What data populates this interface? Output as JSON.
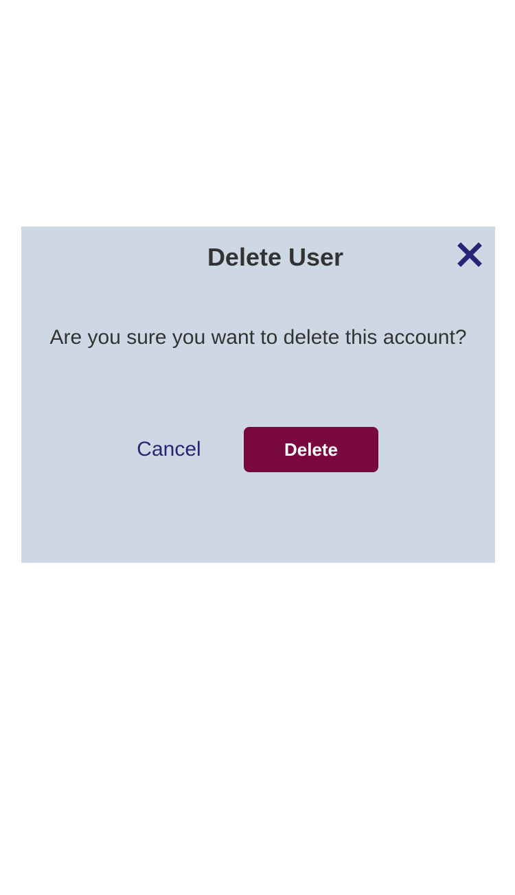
{
  "dialog": {
    "title": "Delete User",
    "message": "Are you sure you want to delete this account?",
    "cancel_label": "Cancel",
    "delete_label": "Delete",
    "close_icon": "close-icon"
  },
  "colors": {
    "dialog_background": "#cdd8e4",
    "title_text": "#333333",
    "close_icon": "#2b2378",
    "cancel_text": "#2b2378",
    "delete_background": "#7a0840",
    "delete_text": "#ffffff"
  }
}
